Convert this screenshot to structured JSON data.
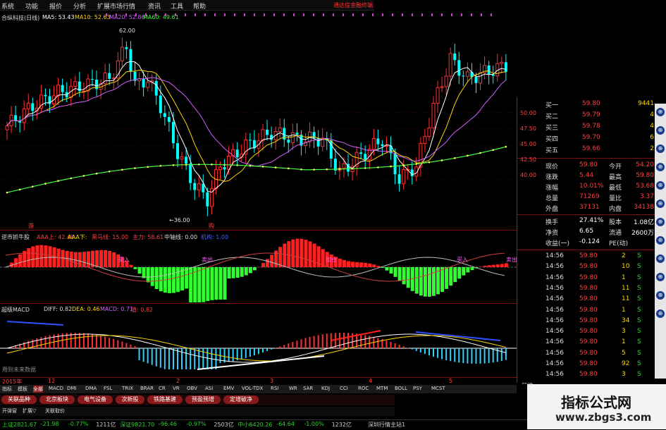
{
  "menu": {
    "items": [
      "系统",
      "功能",
      "报价",
      "分析",
      "扩展市场行情",
      "资讯",
      "工具",
      "帮助"
    ],
    "brand": "通达信金融终端"
  },
  "main_chart": {
    "header": {
      "name": "合纵科技(日线)",
      "ma5": "MA5: 53.43",
      "ma10": "MA10: 52.63",
      "ma20": "MA20: 52.86",
      "ma60": "MA60: 49.61"
    },
    "high_label": "62.00",
    "low_label": "←36.00",
    "y_ticks": [
      "50.00",
      "47.50",
      "45.00",
      "40.00"
    ],
    "price_tag": "42.60",
    "markers": [
      "游",
      "购"
    ]
  },
  "chart_data": [
    {
      "type": "candlestick",
      "title": "合纵科技(日线)",
      "series": [
        {
          "name": "MA5",
          "value": 53.43
        },
        {
          "name": "MA10",
          "value": 52.63
        },
        {
          "name": "MA20",
          "value": 52.86
        },
        {
          "name": "MA60",
          "value": 49.61
        }
      ],
      "annotations": [
        "62.00",
        "←36.00"
      ],
      "yticks": [
        50.0,
        47.5,
        45.0,
        40.0
      ]
    },
    {
      "type": "bar",
      "title": "逆市抓牛股",
      "legend": [
        "AAA上 42.48",
        "AAA下",
        "黑马线 15.00",
        "主力 58.61",
        "中轴线 0.00",
        "机构 1.00"
      ],
      "yticks": [
        150.0,
        0.0
      ]
    },
    {
      "type": "bar",
      "title": "超级MACD",
      "series": [
        {
          "name": "DIFF",
          "value": 0.82
        },
        {
          "name": "DEA",
          "value": 0.46
        },
        {
          "name": "MACD",
          "value": 0.71
        }
      ],
      "legend": [
        "值 0.82"
      ],
      "yticks": [
        5.0,
        2.5,
        0.0
      ]
    }
  ],
  "ind1": {
    "name": "逆市抓牛股",
    "aaa_up": "AAA上: 42.48",
    "aaa_dn": "AAA下:",
    "hm": "黑马线: 15.00",
    "zl": "主力: 58.61",
    "zz": "中轴线: 0.00",
    "jg": "机构: 1.00",
    "t1": "150.00",
    "t0": "0.00",
    "tags": [
      "买入",
      "卖出",
      "加仓",
      "买入",
      "卖出"
    ]
  },
  "ind2": {
    "name": "超级MACD",
    "diff": "DIFF: 0.82",
    "dea": "DEA: 0.46",
    "macd": "MACD: 0.71",
    "val": "值: 0.82",
    "t1": "5.00",
    "t2": "2.50",
    "t0": "0.00",
    "note": "用到未来数据"
  },
  "time_axis": {
    "labels": [
      "2015年",
      "12",
      "2",
      "3",
      "4",
      "5"
    ],
    "period": "日线"
  },
  "orderbook": {
    "asks": [
      {
        "label": "买一",
        "price": "59.80",
        "vol": "9441"
      },
      {
        "label": "买二",
        "price": "59.79",
        "vol": "4"
      },
      {
        "label": "买三",
        "price": "59.78",
        "vol": "4"
      },
      {
        "label": "买四",
        "price": "59.70",
        "vol": "6"
      },
      {
        "label": "买五",
        "price": "59.66",
        "vol": "2"
      }
    ],
    "axis": [
      "50.00",
      "47.50",
      "45.00",
      "42.50",
      "40.00"
    ],
    "quote": [
      {
        "k1": "现价",
        "v1": "59.80",
        "k2": "今开",
        "v2": "54.20"
      },
      {
        "k1": "涨跌",
        "v1": "5.44",
        "k2": "最高",
        "v2": "59.80"
      },
      {
        "k1": "涨幅",
        "v1": "10.01%",
        "k2": "最低",
        "v2": "53.68"
      },
      {
        "k1": "总量",
        "v1": "71269",
        "k2": "量比",
        "v2": "3.37"
      },
      {
        "k1": "外盘",
        "v1": "37131",
        "k2": "内盘",
        "v2": "34138"
      }
    ],
    "stats": [
      {
        "k1": "换手",
        "v1": "27.41%",
        "k2": "股本",
        "v2": "1.08亿"
      },
      {
        "k1": "净资",
        "v1": "6.65",
        "k2": "流通",
        "v2": "2600万"
      },
      {
        "k1": "收益(一)",
        "v1": "-0.124",
        "k2": "PE(动)",
        "v2": ""
      }
    ],
    "ticks": [
      {
        "t": "14:56",
        "p": "59.80",
        "v": "2",
        "d": "S"
      },
      {
        "t": "14:56",
        "p": "59.80",
        "v": "10",
        "d": "S"
      },
      {
        "t": "14:56",
        "p": "59.80",
        "v": "1",
        "d": "S"
      },
      {
        "t": "14:56",
        "p": "59.80",
        "v": "11",
        "d": "S"
      },
      {
        "t": "14:56",
        "p": "59.80",
        "v": "11",
        "d": "S"
      },
      {
        "t": "14:56",
        "p": "59.80",
        "v": "1",
        "d": "S"
      },
      {
        "t": "14:56",
        "p": "59.80",
        "v": "34",
        "d": "S"
      },
      {
        "t": "14:56",
        "p": "59.80",
        "v": "3",
        "d": "S"
      },
      {
        "t": "14:56",
        "p": "59.80",
        "v": "1",
        "d": "S"
      },
      {
        "t": "14:56",
        "p": "59.80",
        "v": "5",
        "d": "S"
      },
      {
        "t": "14:56",
        "p": "59.80",
        "v": "92",
        "d": "S"
      },
      {
        "t": "14:56",
        "p": "59.80",
        "v": "3",
        "d": "S"
      }
    ]
  },
  "indicator_tabs": [
    "指标",
    "模板",
    "全部",
    "MACD",
    "DMI",
    "DMA",
    "FSL",
    "TRIX",
    "BRAR",
    "CR",
    "VR",
    "OBV",
    "ASI",
    "EMV",
    "VOL-TDX",
    "RSI",
    "WR",
    "SAR",
    "KDJ",
    "CCI",
    "ROC",
    "MTM",
    "BOLL",
    "PSY",
    "MCST"
  ],
  "sector_pills": [
    "关联品种",
    "北京板块",
    "电气设备",
    "次新股",
    "铁路基建",
    "预盈预增",
    "定增破净"
  ],
  "bottom_tabs": [
    "开弹窗",
    "扩展▽",
    "关联取价"
  ],
  "status": [
    {
      "text": "上证2821.67",
      "color": "#2ed12e"
    },
    {
      "text": "-21.98",
      "color": "#2ed12e"
    },
    {
      "text": "-0.77%",
      "color": "#2ed12e"
    },
    {
      "text": "1211亿",
      "color": "#cccccc"
    },
    {
      "text": "深证9821.70",
      "color": "#2ed12e"
    },
    {
      "text": "-96.46",
      "color": "#2ed12e"
    },
    {
      "text": "-0.97%",
      "color": "#2ed12e"
    },
    {
      "text": "2503亿",
      "color": "#cccccc"
    },
    {
      "text": "中小6420.26",
      "color": "#2ed12e"
    },
    {
      "text": "-64.64",
      "color": "#2ed12e"
    },
    {
      "text": "-1.00%",
      "color": "#2ed12e"
    },
    {
      "text": "1232亿",
      "color": "#cccccc"
    },
    {
      "text": "深圳行情主站1",
      "color": "#cccccc"
    }
  ],
  "watermark": {
    "title": "指标公式网",
    "url": "www.zbgs3.com"
  },
  "colors": {
    "up": "#ff3030",
    "down": "#00ffff",
    "ma5": "#ffffff",
    "ma10": "#ffd700",
    "ma20": "#d060ff",
    "ma60": "#40ff40",
    "bull": "#ff2020",
    "bear": "#30ff30"
  }
}
